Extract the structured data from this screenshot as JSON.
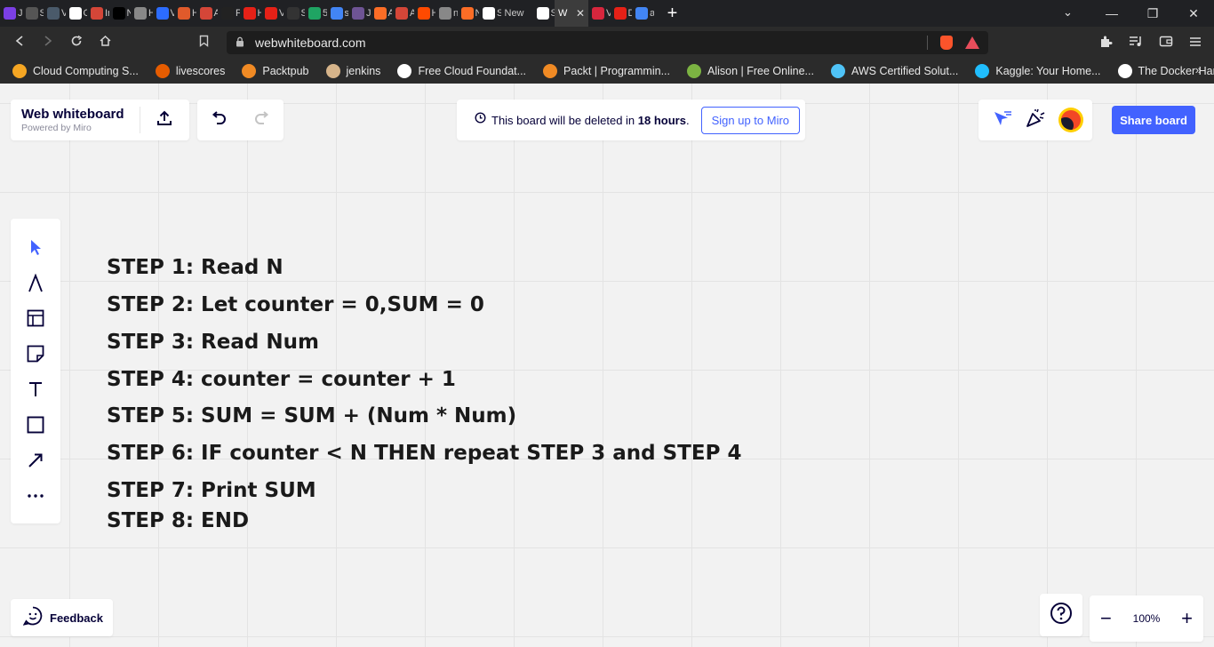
{
  "browser": {
    "tabs": [
      {
        "label": "J",
        "color": "#7b3fe4"
      },
      {
        "label": "S",
        "color": "#555555"
      },
      {
        "label": "V",
        "color": "#4a5a6a"
      },
      {
        "label": "G",
        "color": "#ffffff"
      },
      {
        "label": "Ir",
        "color": "#d44638"
      },
      {
        "label": "N",
        "color": "#000000"
      },
      {
        "label": "H",
        "color": "#888888"
      },
      {
        "label": "V",
        "color": "#2c6cff"
      },
      {
        "label": "H",
        "color": "#e05a2b"
      },
      {
        "label": "A",
        "color": "#d44638"
      },
      {
        "label": "P",
        "color": "#222222"
      },
      {
        "label": "H",
        "color": "#e62117"
      },
      {
        "label": "V",
        "color": "#e62117"
      },
      {
        "label": "S",
        "color": "#333333"
      },
      {
        "label": "5",
        "color": "#1fa463"
      },
      {
        "label": "s",
        "color": "#4285f4"
      },
      {
        "label": "J",
        "color": "#6e5494"
      },
      {
        "label": "A",
        "color": "#fc6d26"
      },
      {
        "label": "A",
        "color": "#d44638"
      },
      {
        "label": "H",
        "color": "#ff4a00"
      },
      {
        "label": "n",
        "color": "#888888"
      },
      {
        "label": "N",
        "color": "#fc6d26"
      },
      {
        "label": "S",
        "color": "#ffffff"
      },
      {
        "label": "New",
        "color": ""
      },
      {
        "label": "S",
        "color": "#ffffff"
      }
    ],
    "active_tab": {
      "label": "W",
      "close": "✕"
    },
    "trailing_tabs": [
      {
        "label": "V",
        "color": "#d7263d"
      },
      {
        "label": "D",
        "color": "#e62117"
      },
      {
        "label": "a",
        "color": "#4285f4"
      }
    ],
    "new_tab": "+",
    "window_controls": {
      "minimize": "—",
      "maximize": "❐",
      "close": "✕"
    },
    "tab_search": "⌄",
    "url": "webwhiteboard.com",
    "bookmarks": [
      {
        "label": "Cloud Computing S...",
        "color": "#f5a623"
      },
      {
        "label": "livescores",
        "color": "#e65c00"
      },
      {
        "label": "Packtpub",
        "color": "#f08a24"
      },
      {
        "label": "jenkins",
        "color": "#d6b48a"
      },
      {
        "label": "Free Cloud Foundat...",
        "color": "#ffffff"
      },
      {
        "label": "Packt | Programmin...",
        "color": "#f08a24"
      },
      {
        "label": "Alison | Free Online...",
        "color": "#7cb342"
      },
      {
        "label": "AWS Certified Solut...",
        "color": "#4fc3f7"
      },
      {
        "label": "Kaggle: Your Home...",
        "color": "#20beff"
      },
      {
        "label": "The Docker Handb...",
        "color": "#ffffff"
      }
    ],
    "bookmarks_more": "»"
  },
  "app": {
    "title": "Web whiteboard",
    "subtitle": "Powered by Miro",
    "notice_prefix": "This board will be deleted in ",
    "notice_bold": "18 hours",
    "notice_suffix": ".",
    "signup_label": "Sign up to Miro",
    "share_label": "Share board",
    "feedback_label": "Feedback",
    "zoom_level": "100%",
    "zoom_out": "−",
    "zoom_in": "+",
    "accent_color": "#4262ff"
  },
  "tools": [
    "select-icon",
    "pen-icon",
    "frame-icon",
    "sticky-note-icon",
    "text-icon",
    "shape-icon",
    "arrow-icon",
    "more-icon"
  ],
  "steps": [
    "STEP 1: Read N",
    "STEP 2: Let counter = 0,SUM = 0",
    "STEP 3: Read Num",
    "STEP 4: counter = counter + 1",
    "STEP 5: SUM = SUM + (Num * Num)",
    "STEP 6: IF counter < N THEN repeat STEP 3 and STEP 4",
    "STEP 7: Print SUM",
    "STEP 8: END"
  ]
}
